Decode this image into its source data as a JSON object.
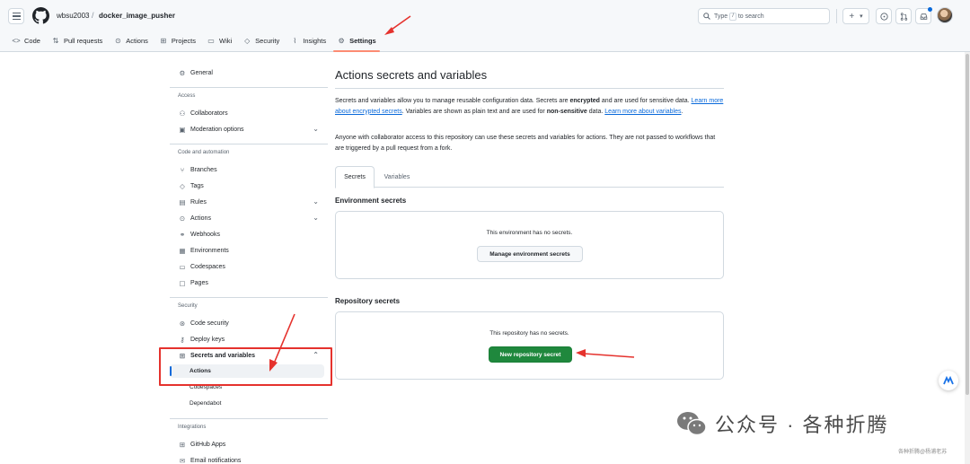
{
  "header": {
    "owner": "wbsu2003",
    "separator": "/",
    "repo": "docker_image_pusher",
    "search_prefix": "Type",
    "search_key": "/",
    "search_suffix": "to search",
    "plus_label": "+",
    "caret": "▾"
  },
  "repo_tabs": [
    {
      "label": "Code",
      "icon": "code-icon"
    },
    {
      "label": "Pull requests",
      "icon": "pull-request-icon"
    },
    {
      "label": "Actions",
      "icon": "play-icon"
    },
    {
      "label": "Projects",
      "icon": "table-icon"
    },
    {
      "label": "Wiki",
      "icon": "book-icon"
    },
    {
      "label": "Security",
      "icon": "shield-icon"
    },
    {
      "label": "Insights",
      "icon": "graph-icon"
    },
    {
      "label": "Settings",
      "icon": "gear-icon",
      "active": true
    }
  ],
  "sidebar": {
    "general": "General",
    "access_heading": "Access",
    "collaborators": "Collaborators",
    "moderation": "Moderation options",
    "code_heading": "Code and automation",
    "branches": "Branches",
    "tags": "Tags",
    "rules": "Rules",
    "actions": "Actions",
    "webhooks": "Webhooks",
    "environments": "Environments",
    "codespaces": "Codespaces",
    "pages": "Pages",
    "security_heading": "Security",
    "code_security": "Code security",
    "deploy_keys": "Deploy keys",
    "secrets_vars": "Secrets and variables",
    "sub_actions": "Actions",
    "sub_codespaces": "Codespaces",
    "sub_dependabot": "Dependabot",
    "integrations_heading": "Integrations",
    "github_apps": "GitHub Apps",
    "email_notifications": "Email notifications"
  },
  "main": {
    "title": "Actions secrets and variables",
    "p1_a": "Secrets and variables allow you to manage reusable configuration data. Secrets are ",
    "p1_b": "encrypted",
    "p1_c": " and are used for sensitive data. ",
    "p1_link1": "Learn more about encrypted secrets",
    "p1_d": ". Variables are shown as plain text and are used for ",
    "p1_e": "non-sensitive",
    "p1_f": " data. ",
    "p1_link2": "Learn more about variables",
    "p1_g": ".",
    "p2": "Anyone with collaborator access to this repository can use these secrets and variables for actions. They are not passed to workflows that are triggered by a pull request from a fork.",
    "tab_secrets": "Secrets",
    "tab_variables": "Variables",
    "env_title": "Environment secrets",
    "env_empty": "This environment has no secrets.",
    "env_button": "Manage environment secrets",
    "repo_title": "Repository secrets",
    "repo_empty": "This repository has no secrets.",
    "repo_button": "New repository secret"
  },
  "watermark": {
    "text": "公众号 · 各种折腾",
    "small": "各种折腾@杨浦老苏"
  },
  "colors": {
    "accent_blue": "#0969da",
    "primary_green": "#1f883d",
    "annotation_red": "#e5322d",
    "tab_underline": "#fd8c73"
  }
}
